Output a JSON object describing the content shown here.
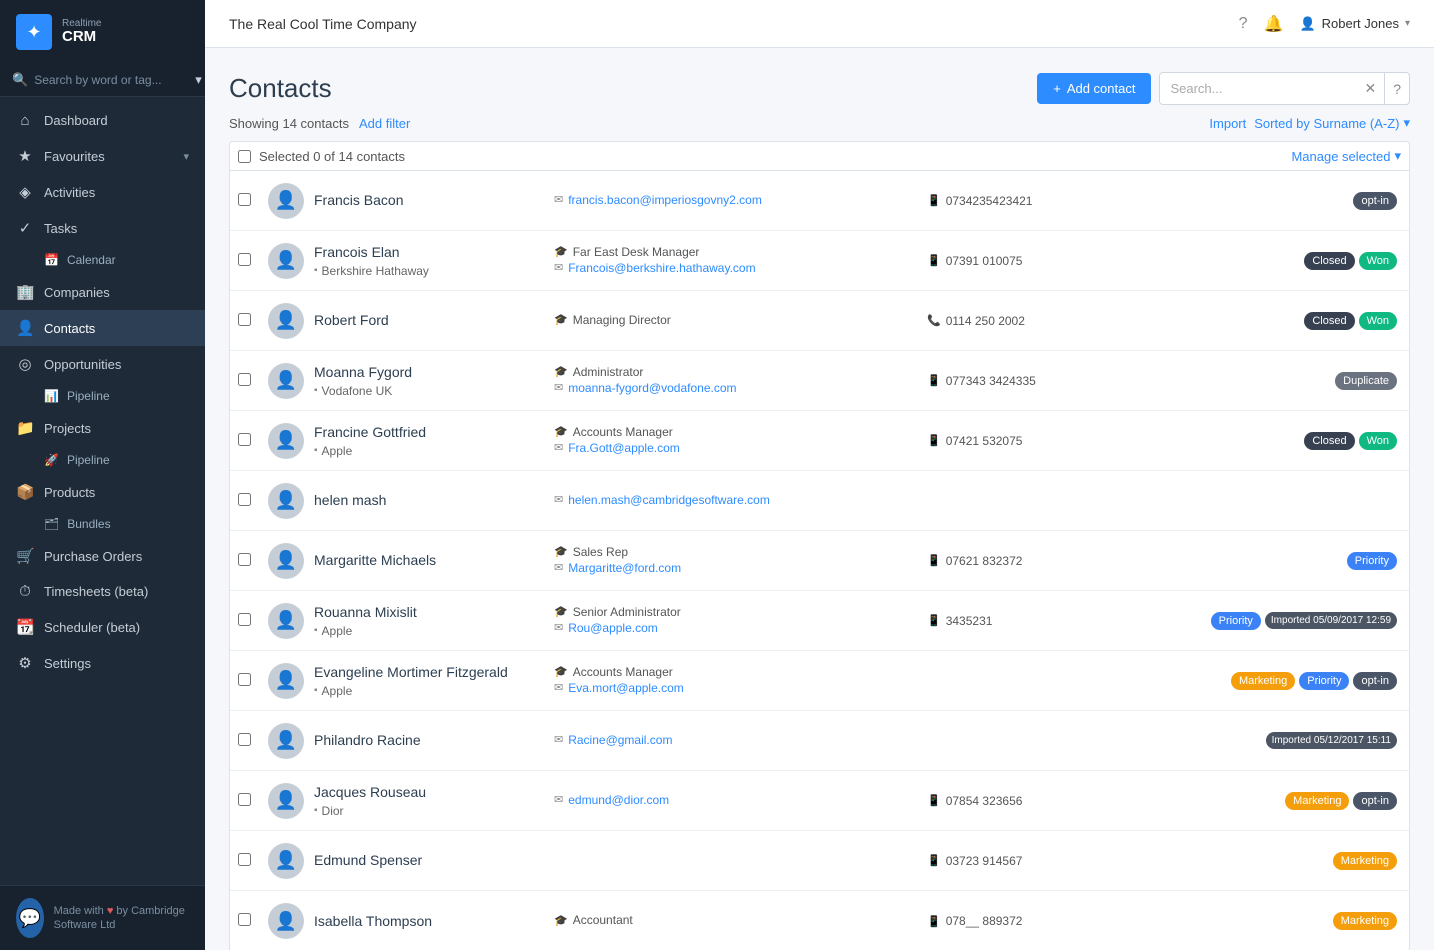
{
  "app": {
    "logo_line1": "Realtime",
    "logo_line2": "CRM",
    "company": "The Real Cool Time Company"
  },
  "topbar": {
    "company": "The Real Cool Time Company",
    "user": "Robert Jones"
  },
  "sidebar": {
    "search_placeholder": "Search by word or tag...",
    "items": [
      {
        "id": "dashboard",
        "icon": "⌂",
        "label": "Dashboard",
        "has_arrow": false
      },
      {
        "id": "favourites",
        "icon": "★",
        "label": "Favourites",
        "has_arrow": true
      },
      {
        "id": "activities",
        "icon": "◈",
        "label": "Activities",
        "has_arrow": false
      },
      {
        "id": "tasks",
        "icon": "✓",
        "label": "Tasks",
        "has_arrow": false
      },
      {
        "id": "calendar",
        "icon": "📅",
        "label": "Calendar",
        "is_sub": true
      },
      {
        "id": "companies",
        "icon": "🏢",
        "label": "Companies",
        "has_arrow": false
      },
      {
        "id": "contacts",
        "icon": "👤",
        "label": "Contacts",
        "has_arrow": false,
        "active": true
      },
      {
        "id": "opportunities",
        "icon": "◎",
        "label": "Opportunities",
        "has_arrow": false
      },
      {
        "id": "pipeline",
        "icon": "📊",
        "label": "Pipeline",
        "is_sub": true
      },
      {
        "id": "projects",
        "icon": "📁",
        "label": "Projects",
        "has_arrow": false
      },
      {
        "id": "proj-pipeline",
        "icon": "🚀",
        "label": "Pipeline",
        "is_sub": true
      },
      {
        "id": "products",
        "icon": "📦",
        "label": "Products",
        "has_arrow": false
      },
      {
        "id": "bundles",
        "icon": "🗂",
        "label": "Bundles",
        "is_sub": true
      },
      {
        "id": "purchase-orders",
        "icon": "🛒",
        "label": "Purchase Orders",
        "has_arrow": false
      },
      {
        "id": "timesheets",
        "icon": "⏱",
        "label": "Timesheets (beta)",
        "has_arrow": false
      },
      {
        "id": "scheduler",
        "icon": "📆",
        "label": "Scheduler (beta)",
        "has_arrow": false
      },
      {
        "id": "settings",
        "icon": "⚙",
        "label": "Settings",
        "has_arrow": false
      }
    ],
    "footer_text1": "Made with",
    "footer_heart": "♥",
    "footer_text2": "by Cambridge Software Ltd"
  },
  "page": {
    "title": "Contacts",
    "add_button": "+ Add contact",
    "search_placeholder": "Search...",
    "showing_text": "Showing 14 contacts",
    "add_filter": "Add filter",
    "import": "Import",
    "sort": "Sorted by Surname (A-Z)",
    "selected_text": "Selected 0 of 14 contacts",
    "manage_selected": "Manage selected"
  },
  "contacts": [
    {
      "id": 1,
      "name": "Francis Bacon",
      "company": null,
      "role": null,
      "email": "francis.bacon@imperiosgovny2.com",
      "phone": "0734235423421",
      "phone_type": "mobile",
      "tags": [
        "opt-in"
      ]
    },
    {
      "id": 2,
      "name": "Francois Elan",
      "company": "Berkshire Hathaway",
      "role": "Far East Desk Manager",
      "email": "Francois@berkshire.hathaway.com",
      "phone": "07391 010075",
      "phone_type": "mobile",
      "tags": [
        "Closed",
        "Won"
      ]
    },
    {
      "id": 3,
      "name": "Robert Ford",
      "company": null,
      "role": "Managing Director",
      "email": null,
      "phone": "0114 250 2002",
      "phone_type": "landline",
      "tags": [
        "Closed",
        "Won"
      ]
    },
    {
      "id": 4,
      "name": "Moanna Fygord",
      "company": "Vodafone UK",
      "role": "Administrator",
      "email": "moanna-fygord@vodafone.com",
      "phone": "077343 3424335",
      "phone_type": "mobile",
      "tags": [
        "Duplicate"
      ]
    },
    {
      "id": 5,
      "name": "Francine Gottfried",
      "company": "Apple",
      "role": "Accounts Manager",
      "email": "Fra.Gott@apple.com",
      "phone": "07421 532075",
      "phone_type": "mobile",
      "tags": [
        "Closed",
        "Won"
      ]
    },
    {
      "id": 6,
      "name": "helen mash",
      "company": null,
      "role": null,
      "email": "helen.mash@cambridgesoftware.com",
      "phone": null,
      "phone_type": null,
      "tags": []
    },
    {
      "id": 7,
      "name": "Margaritte Michaels",
      "company": null,
      "role": "Sales Rep",
      "email": "Margaritte@ford.com",
      "phone": "07621 832372",
      "phone_type": "mobile",
      "tags": [
        "Priority"
      ]
    },
    {
      "id": 8,
      "name": "Rouanna Mixislit",
      "company": "Apple",
      "role": "Senior Administrator",
      "email": "Rou@apple.com",
      "phone": "3435231",
      "phone_type": "mobile",
      "tags": [
        "Priority",
        "Imported 05/09/2017 12:59"
      ]
    },
    {
      "id": 9,
      "name": "Evangeline Mortimer Fitzgerald",
      "company": "Apple",
      "role": "Accounts Manager",
      "email": "Eva.mort@apple.com",
      "phone": null,
      "phone_type": null,
      "tags": [
        "Marketing",
        "Priority",
        "opt-in"
      ]
    },
    {
      "id": 10,
      "name": "Philandro Racine",
      "company": null,
      "role": null,
      "email": "Racine@gmail.com",
      "phone": null,
      "phone_type": null,
      "tags": [
        "Imported 05/12/2017 15:11"
      ]
    },
    {
      "id": 11,
      "name": "Jacques Rouseau",
      "company": "Dior",
      "role": null,
      "email": "edmund@dior.com",
      "phone": "07854 323656",
      "phone_type": "mobile",
      "tags": [
        "Marketing",
        "opt-in"
      ]
    },
    {
      "id": 12,
      "name": "Edmund Spenser",
      "company": null,
      "role": null,
      "email": null,
      "phone": "03723 914567",
      "phone_type": "mobile",
      "tags": [
        "Marketing"
      ]
    },
    {
      "id": 13,
      "name": "Isabella Thompson",
      "company": null,
      "role": "Accountant",
      "email": null,
      "phone": "078__ 889372",
      "phone_type": "mobile",
      "tags": [
        "Marketing"
      ]
    }
  ]
}
